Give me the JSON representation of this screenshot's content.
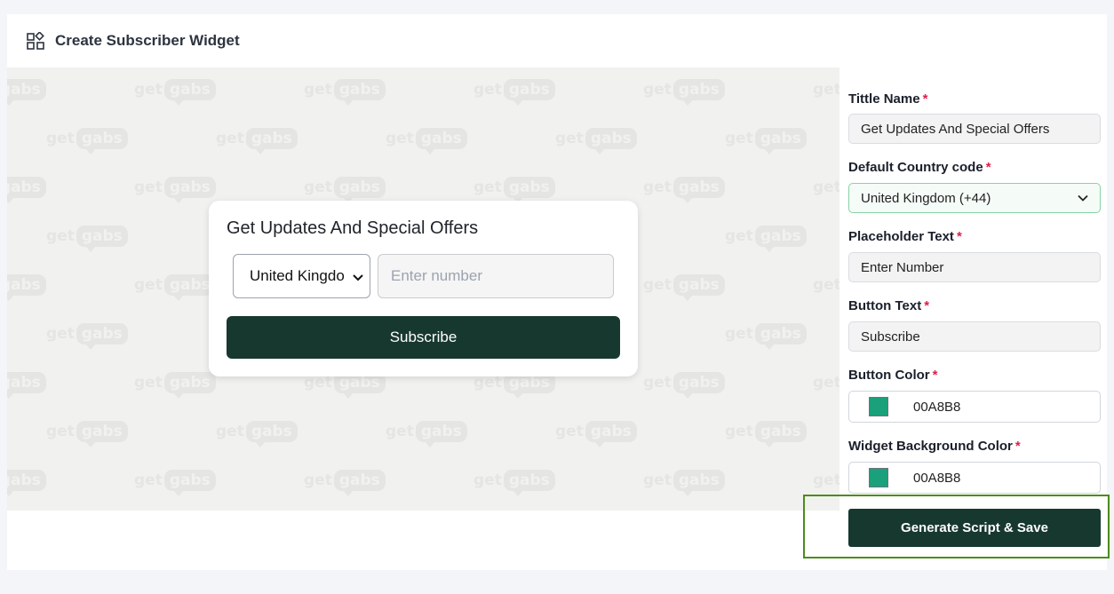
{
  "header": {
    "title": "Create Subscriber Widget",
    "icon": "widgets-icon"
  },
  "preview": {
    "watermark": {
      "get": "get",
      "gabs": "gabs"
    },
    "widget": {
      "title": "Get Updates And Special Offers",
      "country_select_value": "United Kingdo",
      "number_placeholder": "Enter number",
      "button_label": "Subscribe"
    }
  },
  "form": {
    "title_name": {
      "label": "Tittle Name",
      "required_mark": "*",
      "value": "Get Updates And Special Offers"
    },
    "country_code": {
      "label": "Default Country code",
      "required_mark": "*",
      "value": "United Kingdom (+44)"
    },
    "placeholder_text": {
      "label": "Placeholder Text",
      "required_mark": "*",
      "value": "Enter Number"
    },
    "button_text": {
      "label": "Button Text",
      "required_mark": "*",
      "value": "Subscribe"
    },
    "button_color": {
      "label": "Button Color",
      "required_mark": "*",
      "value": "00A8B8",
      "swatch_color": "#1aa07a"
    },
    "widget_bg_color": {
      "label": "Widget Background Color",
      "required_mark": "*",
      "value": "00A8B8",
      "swatch_color": "#1aa07a"
    },
    "submit_label": "Generate Script & Save"
  },
  "colors": {
    "primary_dark": "#17382f",
    "required": "#e11d48",
    "highlight": "#4d8c1c"
  }
}
